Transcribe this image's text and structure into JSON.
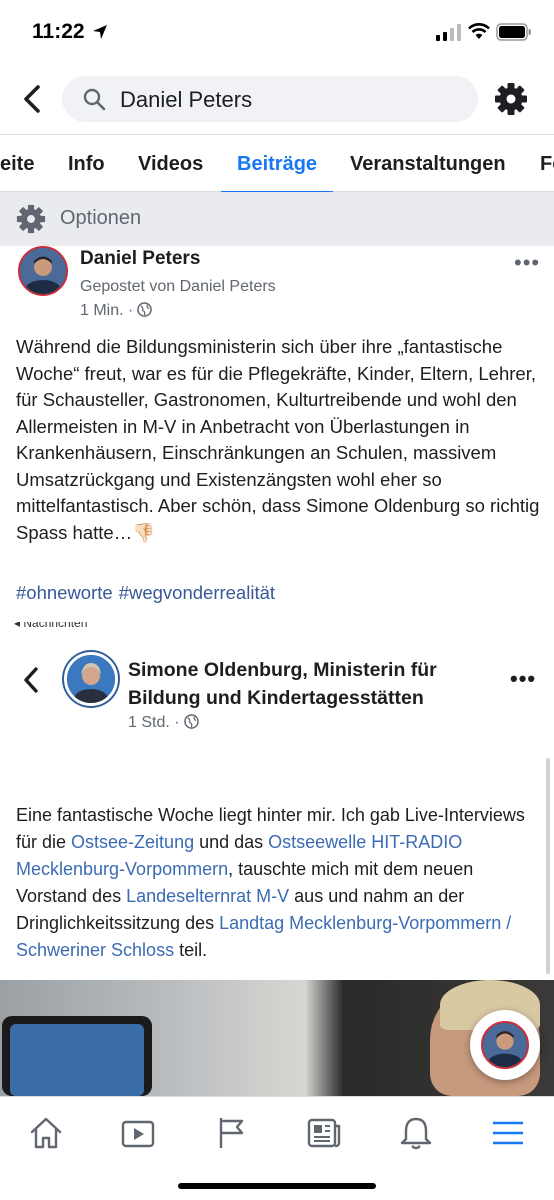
{
  "status_bar": {
    "time": "11:22"
  },
  "search": {
    "query": "Daniel Peters"
  },
  "tabs": [
    {
      "label": "eite"
    },
    {
      "label": "Info"
    },
    {
      "label": "Videos"
    },
    {
      "label": "Beiträge"
    },
    {
      "label": "Veranstaltungen"
    },
    {
      "label": "Fo"
    }
  ],
  "options": {
    "label": "Optionen"
  },
  "post": {
    "author": "Daniel Peters",
    "posted_by": "Gepostet von Daniel Peters",
    "time": "1 Min. ·",
    "more": "•••",
    "body": "Während die Bildungsministerin sich über ihre „fantastische Woche“ freut, war es für die Pflegekräfte, Kinder, Eltern, Lehrer, für Schausteller, Gastronomen, Kulturtreibende und wohl den Allermeisten in M-V in Anbetracht von Überlastungen in Krankenhäusern, Einschränkungen an Schulen, massivem Umsatzrückgang und Existenzängsten wohl eher so mittelfantastisch. Aber schön, dass Simone Oldenburg so richtig Spass hatte…👎🏻",
    "hashtags": [
      "#ohneworte",
      "#wegvonderrealität"
    ]
  },
  "shared_screenshot": {
    "top_crop": "◂ Nachrichten",
    "page_name": "Simone Oldenburg, Ministerin für Bildung und Kindertagesstätten",
    "time": "1 Std. ·",
    "more": "•••",
    "text": {
      "t1": "Eine fantastische Woche liegt hinter mir. Ich gab Live-Interviews für die ",
      "l1": "Ostsee-Zeitung",
      "t2": " und das ",
      "l2": "Ostseewelle HIT-RADIO Mecklenburg-Vorpommern",
      "t3": ", tauschte mich mit dem neuen Vorstand des ",
      "l3": "Landeselternrat M-V",
      "t4": " aus und nahm an der Dringlichkeitssitzung des ",
      "l4": "Landtag Mecklenburg-Vorpommern / Schweriner Schloss",
      "t5": " teil."
    }
  },
  "bottom_nav": [
    "home-icon",
    "video-icon",
    "flag-icon",
    "news-icon",
    "bell-icon",
    "menu-icon"
  ],
  "colors": {
    "accent": "#1877f2",
    "link": "#385898"
  }
}
